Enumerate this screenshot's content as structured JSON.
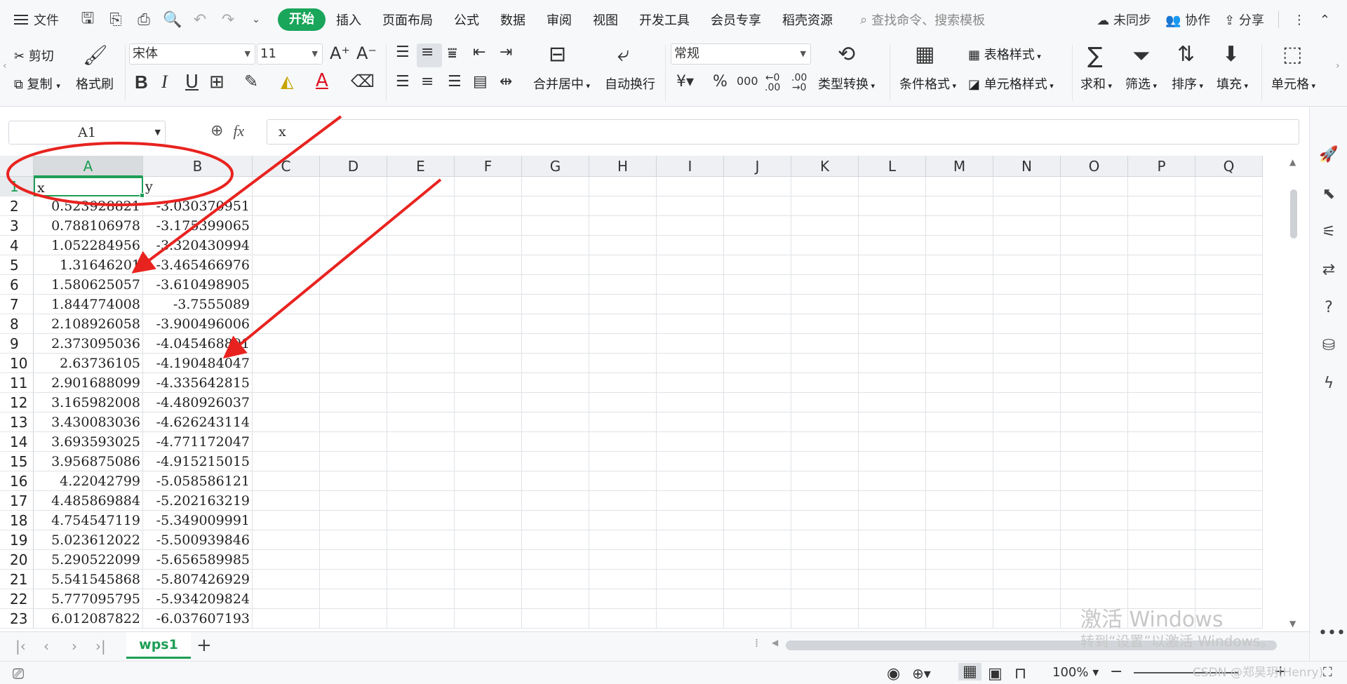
{
  "menubar": {
    "file_label": "文件",
    "tabs": [
      "开始",
      "插入",
      "页面布局",
      "公式",
      "数据",
      "审阅",
      "视图",
      "开发工具",
      "会员专享",
      "稻壳资源"
    ],
    "active_tab": "开始",
    "search_placeholder": "查找命令、搜索模板",
    "sync_label": "未同步",
    "collab_label": "协作",
    "share_label": "分享"
  },
  "ribbon": {
    "cut": "剪切",
    "copy": "复制",
    "format_painter": "格式刷",
    "font_name": "宋体",
    "font_size": "11",
    "merge_center": "合并居中",
    "wrap_text": "自动换行",
    "number_format": "常规",
    "type_convert": "类型转换",
    "conditional_format": "条件格式",
    "table_style": "表格样式",
    "cell_style": "单元格样式",
    "sum": "求和",
    "filter": "筛选",
    "sort": "排序",
    "fill": "填充",
    "cell": "单元格"
  },
  "formula_bar": {
    "name_box": "A1",
    "fx_label": "fx",
    "formula_value": "x"
  },
  "sheet": {
    "columns": [
      "A",
      "B",
      "C",
      "D",
      "E",
      "F",
      "G",
      "H",
      "I",
      "J",
      "K",
      "L",
      "M",
      "N",
      "O",
      "P",
      "Q"
    ],
    "row_numbers": [
      "1",
      "2",
      "3",
      "4",
      "5",
      "6",
      "7",
      "8",
      "9",
      "10",
      "11",
      "12",
      "13",
      "14",
      "15",
      "16",
      "17",
      "18",
      "19",
      "20",
      "21",
      "22",
      "23"
    ],
    "header_row": [
      "x",
      "y"
    ],
    "rows": [
      [
        "0.523928821",
        "-3.030370951"
      ],
      [
        "0.788106978",
        "-3.175399065"
      ],
      [
        "1.052284956",
        "-3.320430994"
      ],
      [
        "1.31646201",
        "-3.465466976"
      ],
      [
        "1.580625057",
        "-3.610498905"
      ],
      [
        "1.844774008",
        "-3.7555089"
      ],
      [
        "2.108926058",
        "-3.900496006"
      ],
      [
        "2.373095036",
        "-4.045468801"
      ],
      [
        "2.63736105",
        "-4.190484047"
      ],
      [
        "2.901688099",
        "-4.335642815"
      ],
      [
        "3.165982008",
        "-4.480926037"
      ],
      [
        "3.430083036",
        "-4.626243114"
      ],
      [
        "3.693593025",
        "-4.771172047"
      ],
      [
        "3.956875086",
        "-4.915215015"
      ],
      [
        "4.22042799",
        "-5.058586121"
      ],
      [
        "4.485869884",
        "-5.202163219"
      ],
      [
        "4.754547119",
        "-5.349009991"
      ],
      [
        "5.023612022",
        "-5.500939846"
      ],
      [
        "5.290522099",
        "-5.656589985"
      ],
      [
        "5.541545868",
        "-5.807426929"
      ],
      [
        "5.777095795",
        "-5.934209824"
      ],
      [
        "6.012087822",
        "-6.037607193"
      ]
    ],
    "sheet_tab": "wps1"
  },
  "statusbar": {
    "zoom": "100%"
  },
  "watermark": {
    "line1": "激活 Windows",
    "line2": "转到“设置”以激活 Windows。",
    "credit": "CSDN @郑昊玥(Henry)"
  },
  "colors": {
    "accent": "#1e9e56",
    "annotation": "#e8231f"
  }
}
